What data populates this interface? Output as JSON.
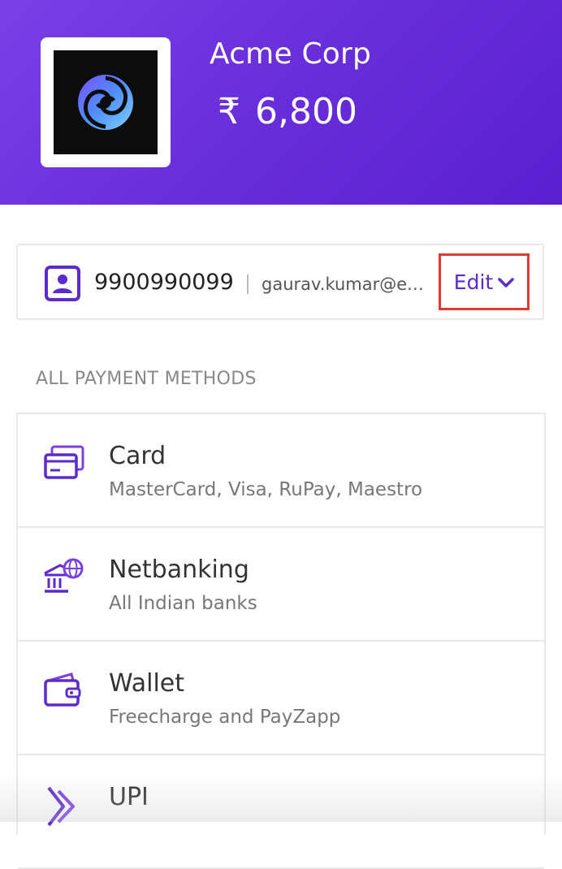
{
  "header": {
    "merchant_name": "Acme Corp",
    "currency_symbol": "₹",
    "amount": "6,800"
  },
  "contact": {
    "phone": "9900990099",
    "email": "gaurav.kumar@example.com",
    "edit_label": "Edit",
    "icon": "contact-card-icon"
  },
  "section_label": "ALL PAYMENT METHODS",
  "methods": [
    {
      "title": "Card",
      "subtitle": "MasterCard, Visa, RuPay, Maestro",
      "icon": "card-icon"
    },
    {
      "title": "Netbanking",
      "subtitle": "All Indian banks",
      "icon": "bank-icon"
    },
    {
      "title": "Wallet",
      "subtitle": "Freecharge and PayZapp",
      "icon": "wallet-icon"
    },
    {
      "title": "UPI",
      "subtitle": "",
      "icon": "upi-icon"
    }
  ],
  "colors": {
    "brand": "#6a2fdc",
    "accent": "#5b2bcb",
    "highlight": "#e23b2c"
  }
}
